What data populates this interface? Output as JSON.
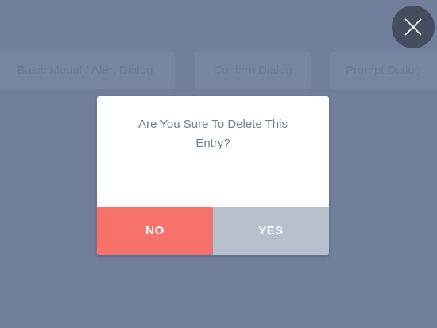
{
  "background_buttons": [
    {
      "label": "Basic Modal / Alert Dialog"
    },
    {
      "label": "Confirm Dialog"
    },
    {
      "label": "Prompt Dialog"
    }
  ],
  "close": {
    "icon": "close-icon"
  },
  "dialog": {
    "message": "Are You Sure To Delete This Entry?",
    "no_label": "NO",
    "yes_label": "YES"
  },
  "colors": {
    "overlay": "#717f9c",
    "no_button": "#f6726a",
    "yes_button": "#b7bfcd",
    "close_button": "#454d5f",
    "message_text": "#717d91"
  }
}
